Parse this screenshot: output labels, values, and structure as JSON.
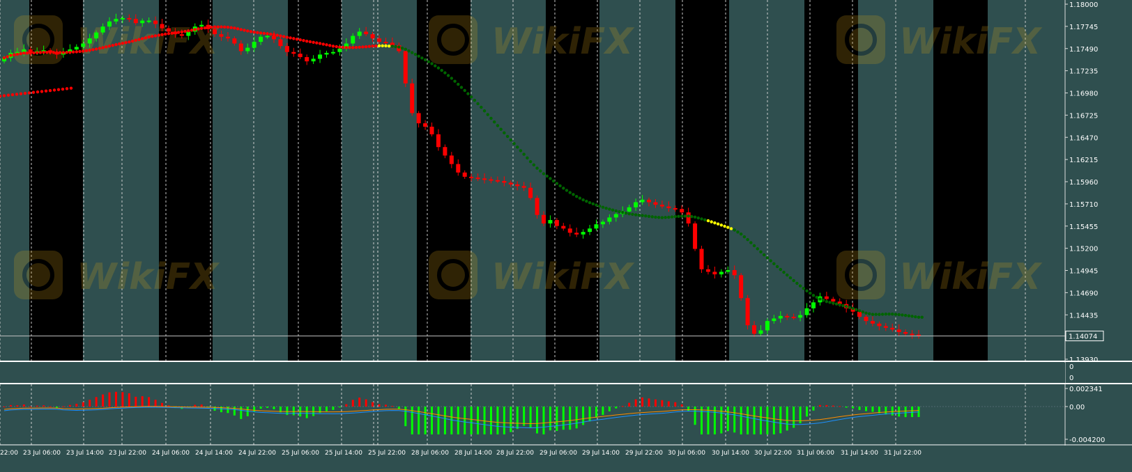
{
  "colors": {
    "bg_band": "#2f4f4f",
    "dark_band": "#000000",
    "frame": "#dcdcdc",
    "grid": "#dcdcdc",
    "text": "#ffffff",
    "candle_bull": "#00ff00",
    "candle_bear": "#ff0000",
    "ma_red": "#ff0000",
    "ma_green": "#006400",
    "ma_yellow": "#ffff00",
    "macd_hist_pos": "#ff0000",
    "macd_hist_neg": "#00ff00",
    "macd_line_blue": "#1e90ff",
    "macd_line_orange": "#ff8c00",
    "watermark": "#d4a017"
  },
  "watermark_text": "WikiFX",
  "subwindow": {
    "ticks": [
      "0",
      "0"
    ]
  },
  "main": {
    "price_label": "1.14074",
    "y_ticks": [
      "1.18000",
      "1.17745",
      "1.17490",
      "1.17235",
      "1.16980",
      "1.16725",
      "1.16470",
      "1.16215",
      "1.15960",
      "1.15710",
      "1.15455",
      "1.15200",
      "1.14945",
      "1.14690",
      "1.14435",
      "1.14180",
      "1.13930"
    ]
  },
  "macd": {
    "y_ticks": [
      "0.002341",
      "0.00",
      "-0.004200"
    ]
  },
  "time_axis": {
    "labels": [
      "22:00",
      "23 Jul 06:00",
      "23 Jul 14:00",
      "23 Jul 22:00",
      "24 Jul 06:00",
      "24 Jul 14:00",
      "24 Jul 22:00",
      "25 Jul 06:00",
      "25 Jul 14:00",
      "25 Jul 22:00",
      "28 Jul 06:00",
      "28 Jul 14:00",
      "28 Jul 22:00",
      "29 Jul 06:00",
      "29 Jul 14:00",
      "29 Jul 22:00",
      "30 Jul 06:00",
      "30 Jul 14:00",
      "30 Jul 22:00",
      "31 Jul 06:00",
      "31 Jul 14:00",
      "31 Jul 22:00"
    ]
  },
  "chart_data": {
    "type": "line",
    "title": "",
    "series": [
      {
        "name": "",
        "values": [
          1.1735,
          1.1741,
          1.1742,
          1.1745,
          1.1741,
          1.1743,
          1.1744,
          1.1742,
          1.1739,
          1.1742,
          1.1745,
          1.1748,
          1.1752,
          1.1758,
          1.1765,
          1.1772,
          1.1778,
          1.1781,
          1.1782,
          1.1781,
          1.1776,
          1.1779,
          1.1779,
          1.1775,
          1.177,
          1.1766,
          1.1763,
          1.1761,
          1.1766,
          1.1772,
          1.1774,
          1.1769,
          1.1763,
          1.176,
          1.1758,
          1.1752,
          1.1743,
          1.1747,
          1.1754,
          1.176,
          1.1761,
          1.1757,
          1.1749,
          1.1742,
          1.174,
          1.1736,
          1.1731,
          1.1734,
          1.1739,
          1.1741,
          1.1742,
          1.1746,
          1.1752,
          1.1761,
          1.1766,
          1.1763,
          1.1758,
          1.1754,
          1.1753,
          1.175,
          1.1743,
          1.1705,
          1.167,
          1.1658,
          1.1654,
          1.1645,
          1.163,
          1.162,
          1.161,
          1.16,
          1.1595,
          1.1594,
          1.1593,
          1.1592,
          1.1591,
          1.159,
          1.1588,
          1.1586,
          1.1584,
          1.1582,
          1.157,
          1.155,
          1.154,
          1.1544,
          1.1537,
          1.1534,
          1.1529,
          1.1527,
          1.153,
          1.1534,
          1.1539,
          1.1542,
          1.1547,
          1.1551,
          1.1554,
          1.1559,
          1.1565,
          1.1568,
          1.1565,
          1.1562,
          1.156,
          1.1558,
          1.1557,
          1.1553,
          1.154,
          1.151,
          1.1486,
          1.1483,
          1.148,
          1.1483,
          1.1485,
          1.1479,
          1.1452,
          1.142,
          1.141,
          1.1414,
          1.1425,
          1.1428,
          1.1431,
          1.143,
          1.1429,
          1.1432,
          1.144,
          1.1447,
          1.1454,
          1.1451,
          1.1448,
          1.1445,
          1.144,
          1.1436,
          1.143,
          1.1425,
          1.1422,
          1.1419,
          1.1417,
          1.1415,
          1.1412,
          1.141,
          1.1409,
          1.1408
        ]
      }
    ],
    "ylim": [
      1.138,
      1.18
    ]
  }
}
